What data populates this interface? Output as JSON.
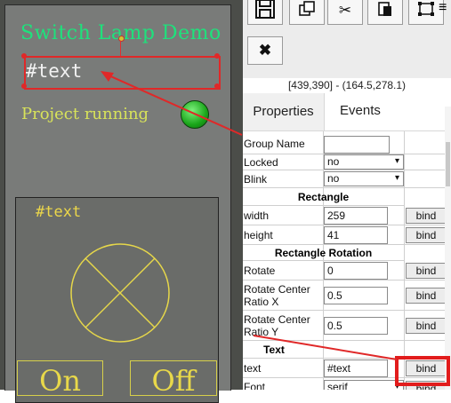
{
  "canvas": {
    "title": "Switch Lamp Demo",
    "selected_text": "#text",
    "status_text": "Project running",
    "panel_text": "#text",
    "on_label": "On",
    "off_label": "Off",
    "lamp_color": "#1aa61a",
    "accent_title_color": "#1ee27c",
    "yellow_color": "#ecd74a"
  },
  "toolbar": {
    "buttons": [
      {
        "icon": "save-icon",
        "glyph": "💾"
      },
      {
        "icon": "copy-icon",
        "glyph": "⧉"
      },
      {
        "icon": "cut-icon",
        "glyph": "✂"
      },
      {
        "icon": "paste-icon",
        "glyph": "📋"
      },
      {
        "icon": "select-icon",
        "glyph": "⬚"
      },
      {
        "icon": "close-icon",
        "glyph": "✖"
      }
    ]
  },
  "coords": "[439,390] - (164.5,278.1)",
  "tabs": {
    "properties": "Properties",
    "events": "Events"
  },
  "props": {
    "group_name": {
      "label": "Group Name",
      "value": ""
    },
    "locked": {
      "label": "Locked",
      "value": "no"
    },
    "blink": {
      "label": "Blink",
      "value": "no"
    },
    "rectangle": "Rectangle",
    "width": {
      "label": "width",
      "value": "259"
    },
    "height": {
      "label": "height",
      "value": "41"
    },
    "rect_rotation": "Rectangle Rotation",
    "rotate": {
      "label": "Rotate",
      "value": "0"
    },
    "rcx": {
      "label": "Rotate Center Ratio X",
      "value": "0.5"
    },
    "rcy": {
      "label": "Rotate Center Ratio Y",
      "value": "0.5"
    },
    "text_section": "Text",
    "text": {
      "label": "text",
      "value": "#text"
    },
    "font": {
      "label": "Font",
      "value": "serif"
    },
    "bind_label": "bind"
  }
}
